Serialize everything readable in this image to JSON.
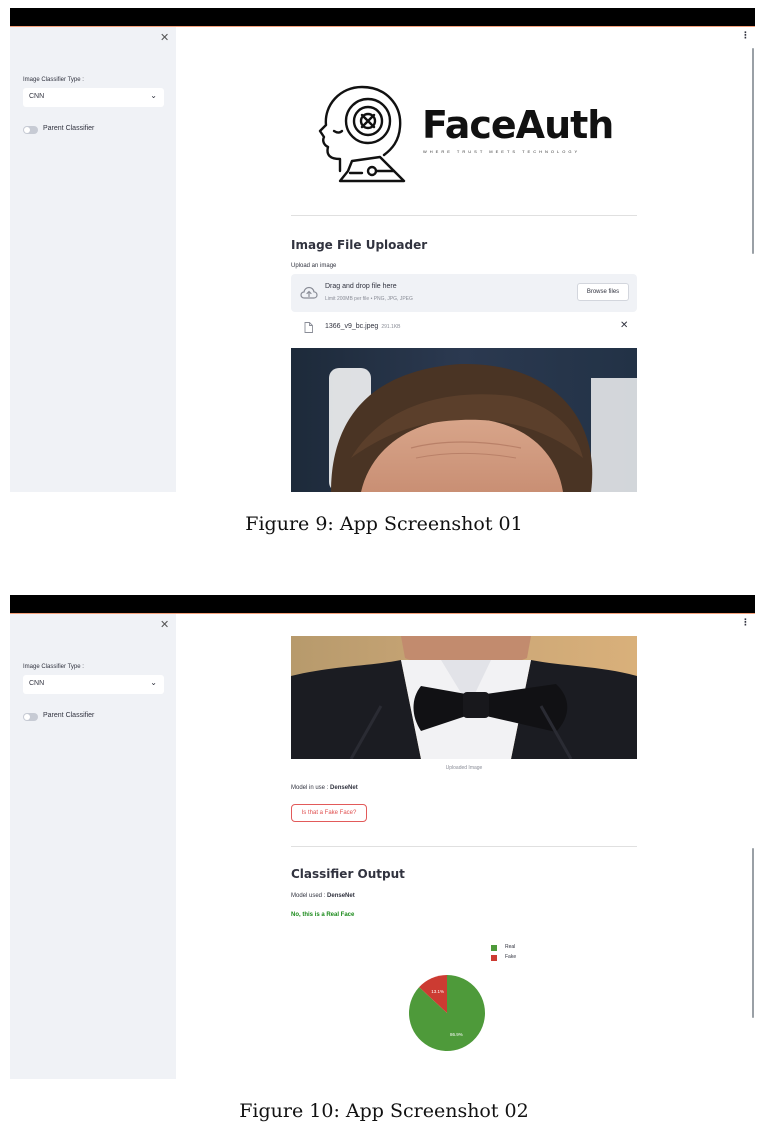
{
  "figures": [
    {
      "caption": "Figure 9: App Screenshot 01",
      "sidebar": {
        "classifier_label": "Image Classifier Type :",
        "classifier_value": "CNN",
        "toggle_label": "Parent Classifier"
      },
      "logo": {
        "title": "FaceAuth",
        "tagline": "WHERE TRUST MEETS TECHNOLOGY"
      },
      "uploader": {
        "heading": "Image File Uploader",
        "field_label": "Upload an image",
        "drop_title": "Drag and drop file here",
        "drop_limit": "Limit 200MB per file • PNG, JPG, JPEG",
        "browse_label": "Browse files",
        "file_name": "1366_v9_bc.jpeg",
        "file_size": "291.1KB"
      }
    },
    {
      "caption": "Figure 10: App Screenshot 02",
      "sidebar": {
        "classifier_label": "Image Classifier Type :",
        "classifier_value": "CNN",
        "toggle_label": "Parent Classifier"
      },
      "image_caption": "Uploaded Image",
      "model_in_use_label": "Model in use : ",
      "model_in_use_value": "DenseNet",
      "check_button": "Is that a Fake Face?",
      "output_heading": "Classifier Output",
      "model_used_label": "Model used : ",
      "model_used_value": "DenseNet",
      "result_text": "No, this is a Real Face"
    }
  ],
  "chart_data": {
    "type": "pie",
    "categories": [
      "Real",
      "Fake"
    ],
    "values": [
      86.9,
      13.1
    ],
    "labels": [
      "86.9%",
      "13.1%"
    ],
    "colors": [
      "#4e9a3a",
      "#cc3b32"
    ],
    "legend_position": "top-right"
  }
}
